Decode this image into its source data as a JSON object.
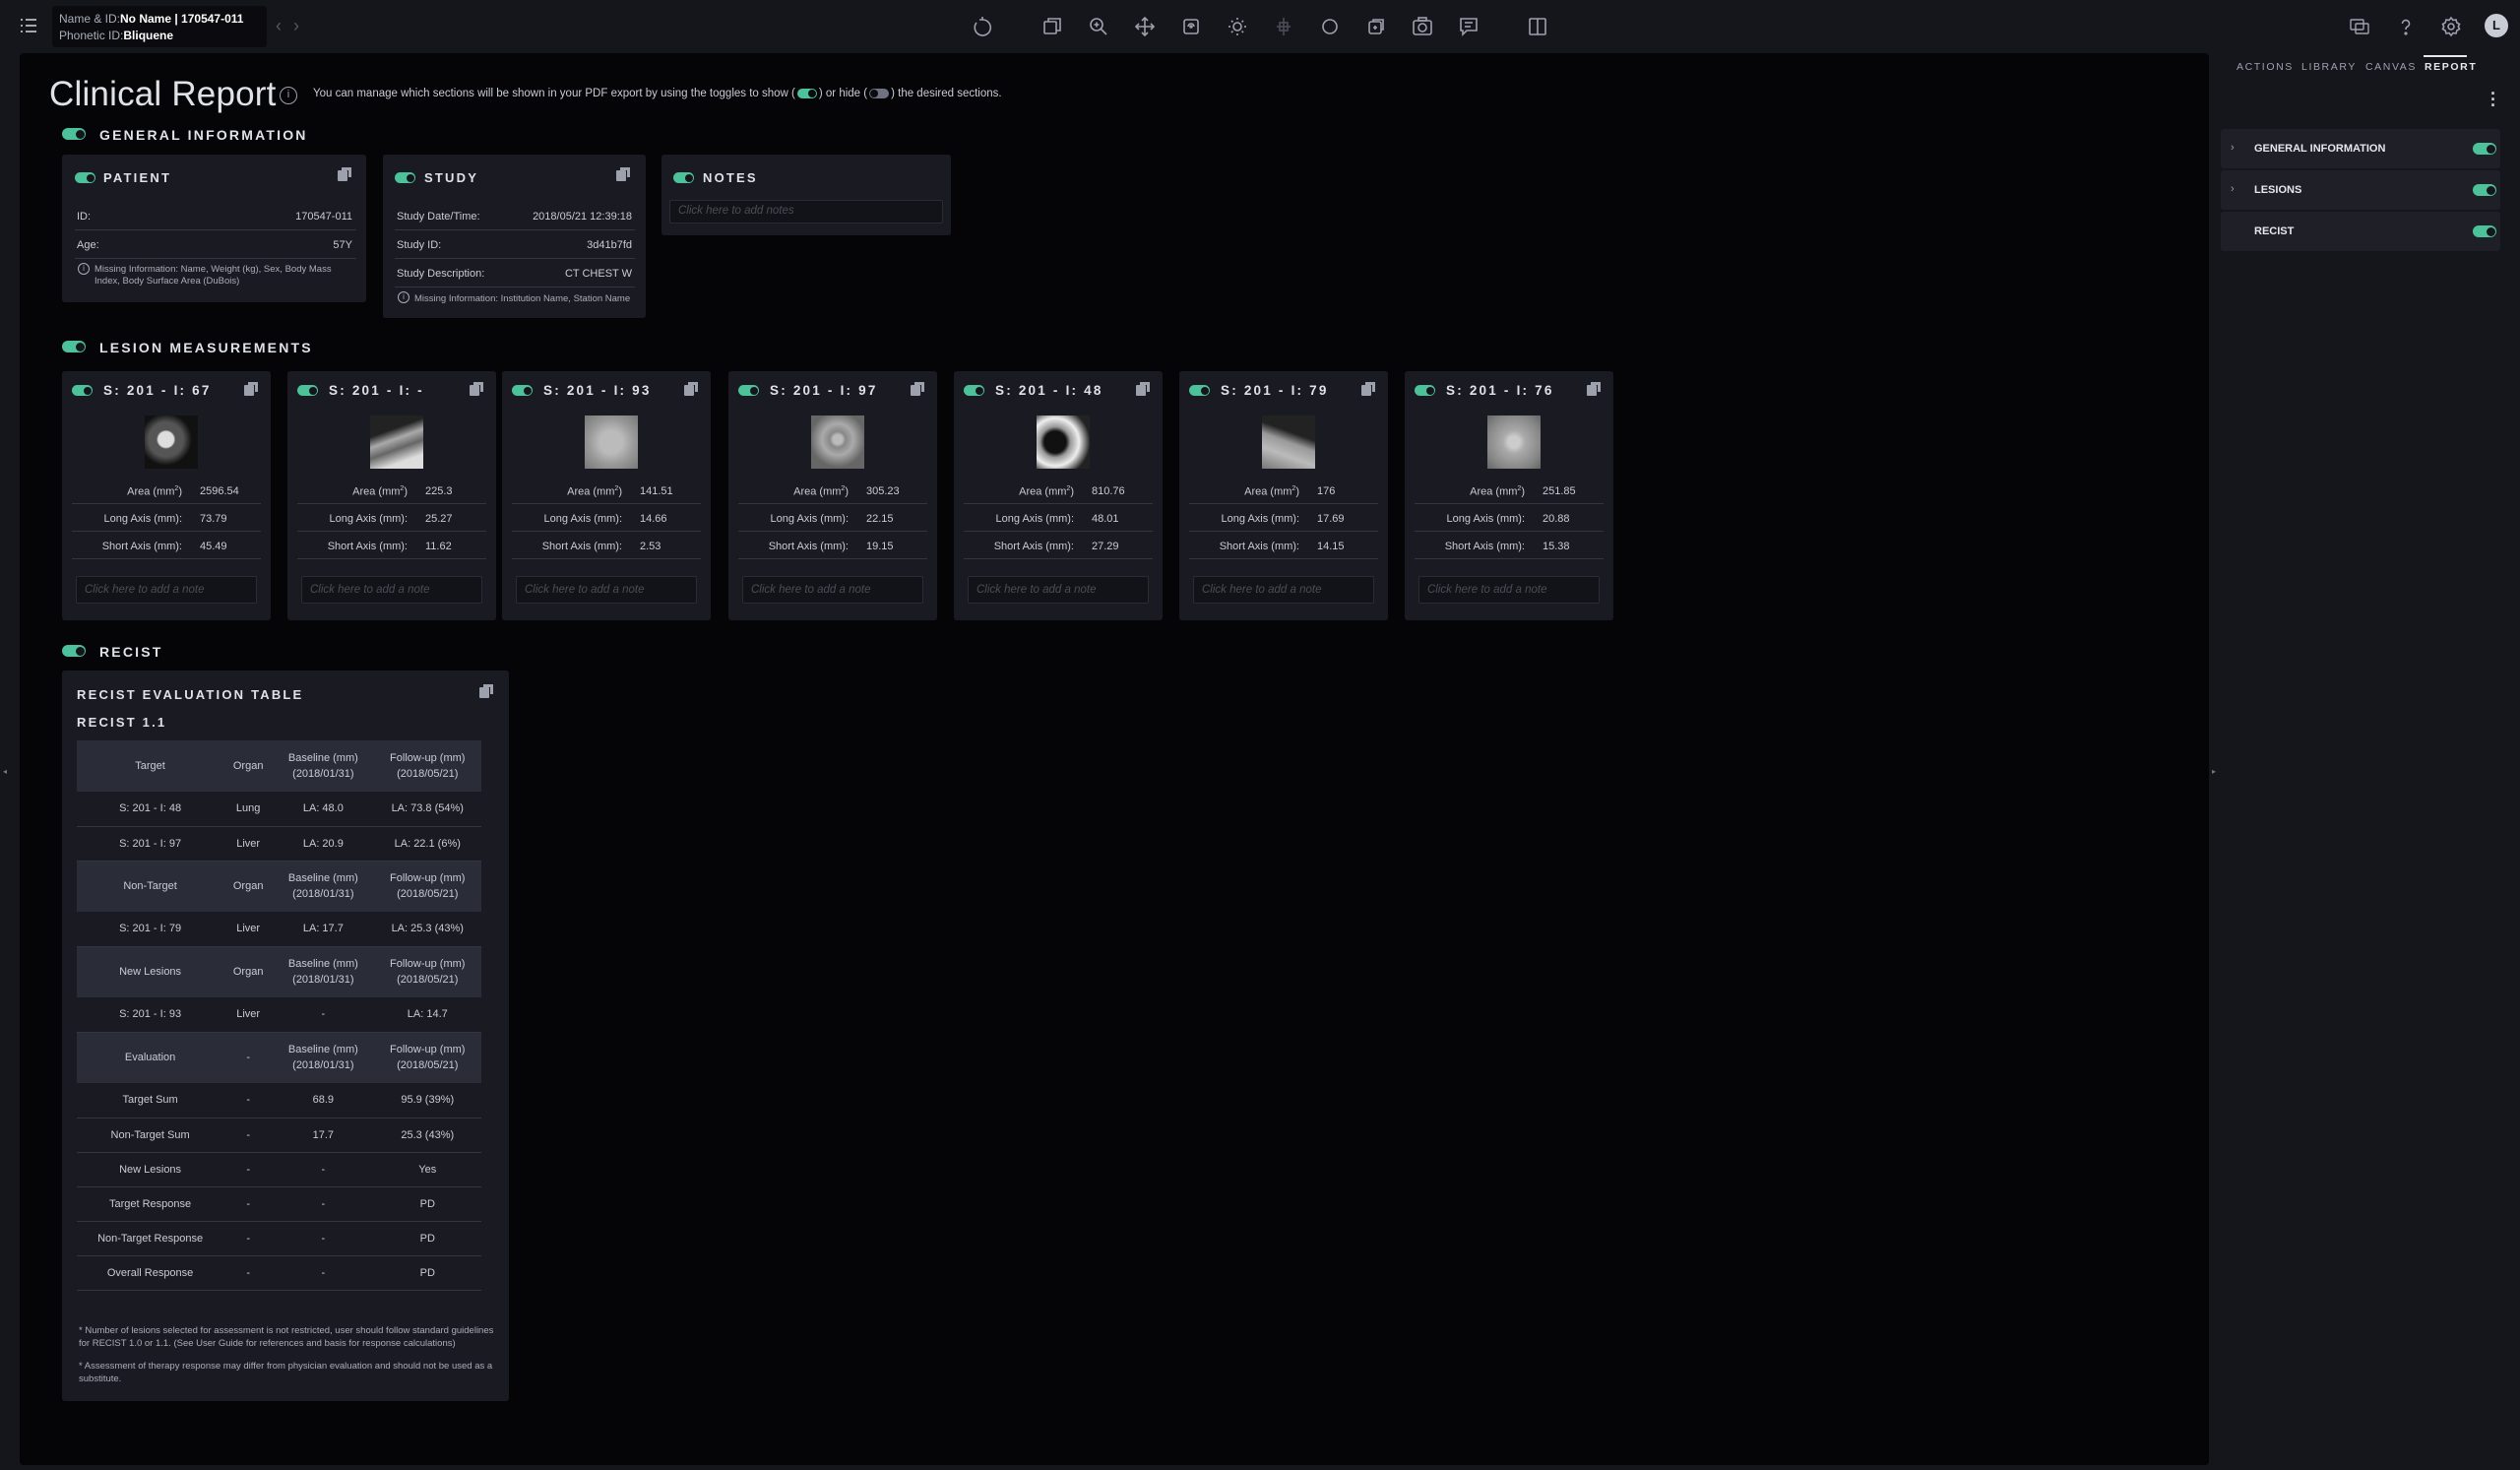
{
  "header": {
    "name_id_label": "Name & ID:",
    "name_id_value": "No Name | 170547-011",
    "phonetic_label": "Phonetic ID:",
    "phonetic_value": "Bliquene",
    "avatar_letter": "L"
  },
  "report": {
    "title": "Clinical Report",
    "hint_prefix": "You can manage which sections will be shown in your PDF export by using the toggles to show (",
    "hint_mid": ") or hide (",
    "hint_suffix": ") the desired sections."
  },
  "general": {
    "title": "GENERAL INFORMATION",
    "patient": {
      "title": "PATIENT",
      "id_label": "ID:",
      "id_value": "170547-011",
      "age_label": "Age:",
      "age_value": "57Y",
      "missing": "Missing Information: Name, Weight (kg), Sex, Body Mass Index, Body Surface Area (DuBois)"
    },
    "study": {
      "title": "STUDY",
      "date_label": "Study Date/Time:",
      "date_value": "2018/05/21  12:39:18",
      "sid_label": "Study ID:",
      "sid_value": "3d41b7fd",
      "desc_label": "Study Description:",
      "desc_value": "CT CHEST W",
      "missing": "Missing Information: Institution Name, Station Name"
    },
    "notes": {
      "title": "NOTES",
      "placeholder": "Click here to add notes"
    }
  },
  "lesions": {
    "title": "LESION MEASUREMENTS",
    "area_label": "Area (mm²)",
    "long_label": "Long Axis (mm):",
    "short_label": "Short Axis (mm):",
    "note_placeholder": "Click here to add a note",
    "items": [
      {
        "title": "S: 201 - I: 67",
        "area": "2596.54",
        "long": "73.79",
        "short": "45.49"
      },
      {
        "title": "S: 201 - I: -",
        "area": "225.3",
        "long": "25.27",
        "short": "11.62"
      },
      {
        "title": "S: 201 - I: 93",
        "area": "141.51",
        "long": "14.66",
        "short": "2.53"
      },
      {
        "title": "S: 201 - I: 97",
        "area": "305.23",
        "long": "22.15",
        "short": "19.15"
      },
      {
        "title": "S: 201 - I: 48",
        "area": "810.76",
        "long": "48.01",
        "short": "27.29"
      },
      {
        "title": "S: 201 - I: 79",
        "area": "176",
        "long": "17.69",
        "short": "14.15"
      },
      {
        "title": "S: 201 - I: 76",
        "area": "251.85",
        "long": "20.88",
        "short": "15.38"
      }
    ]
  },
  "recist": {
    "title": "RECIST",
    "card_title": "RECIST EVALUATION TABLE",
    "version": "RECIST 1.1",
    "col_organ": "Organ",
    "col_baseline": "Baseline (mm)",
    "col_baseline_date": "(2018/01/31)",
    "col_followup": "Follow-up (mm)",
    "col_followup_date": "(2018/05/21)",
    "target_hdr": "Target",
    "nontarget_hdr": "Non-Target",
    "newlesions_hdr": "New Lesions",
    "evaluation_hdr": "Evaluation",
    "dash": "-",
    "target_rows": [
      {
        "lesion": "S: 201 - I: 48",
        "organ": "Lung",
        "baseline": "LA: 48.0",
        "followup": "LA: 73.8 (54%)"
      },
      {
        "lesion": "S: 201 - I: 97",
        "organ": "Liver",
        "baseline": "LA: 20.9",
        "followup": "LA: 22.1 (6%)"
      }
    ],
    "nontarget_rows": [
      {
        "lesion": "S: 201 - I: 79",
        "organ": "Liver",
        "baseline": "LA: 17.7",
        "followup": "LA: 25.3 (43%)"
      }
    ],
    "newlesion_rows": [
      {
        "lesion": "S: 201 - I: 93",
        "organ": "Liver",
        "baseline": "-",
        "followup": "LA: 14.7"
      }
    ],
    "evaluation_rows": [
      {
        "label": "Target Sum",
        "organ": "-",
        "baseline": "68.9",
        "followup": "95.9 (39%)"
      },
      {
        "label": "Non-Target Sum",
        "organ": "-",
        "baseline": "17.7",
        "followup": "25.3 (43%)"
      },
      {
        "label": "New Lesions",
        "organ": "-",
        "baseline": "-",
        "followup": "Yes"
      },
      {
        "label": "Target Response",
        "organ": "-",
        "baseline": "-",
        "followup": "PD"
      },
      {
        "label": "Non-Target Response",
        "organ": "-",
        "baseline": "-",
        "followup": "PD"
      },
      {
        "label": "Overall Response",
        "organ": "-",
        "baseline": "-",
        "followup": "PD"
      }
    ],
    "footnote1": "* Number of lesions selected for assessment is not restricted, user should follow standard guidelines for RECIST 1.0 or 1.1. (See User Guide for references and basis for response calculations)",
    "footnote2": "* Assessment of therapy response may differ from physician evaluation and should not be used as a substitute."
  },
  "right_panel": {
    "tabs": [
      "ACTIONS",
      "LIBRARY",
      "CANVAS",
      "REPORT"
    ],
    "active_tab": "REPORT",
    "items": [
      "GENERAL INFORMATION",
      "LESIONS",
      "RECIST"
    ],
    "chevron": "›"
  },
  "colors": {
    "accent": "#4dc29a",
    "panel": "#1a1b22",
    "background": "#050508"
  },
  "icons": [
    "menu-icon",
    "chevron-left-icon",
    "chevron-right-icon",
    "reset-icon",
    "layers-icon",
    "zoom-icon",
    "pan-icon",
    "rotate-icon",
    "brightness-icon",
    "crosshair-icon",
    "ellipse-icon",
    "link-icon",
    "camera-icon",
    "comment-icon",
    "layout-icon",
    "chat-icon",
    "help-icon",
    "settings-icon",
    "info-icon",
    "copy-icon"
  ]
}
